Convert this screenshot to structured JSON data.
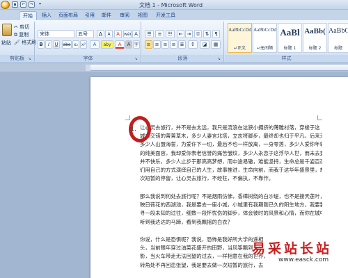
{
  "window": {
    "title": "文档 1 - Microsoft Word"
  },
  "quick_access": [
    "save-icon",
    "undo-icon",
    "redo-icon",
    "dropdown-icon"
  ],
  "tabs": [
    {
      "label": "开始",
      "active": true
    },
    {
      "label": "插入"
    },
    {
      "label": "页面布局"
    },
    {
      "label": "引用"
    },
    {
      "label": "邮件"
    },
    {
      "label": "审阅"
    },
    {
      "label": "视图"
    },
    {
      "label": "开发工具"
    }
  ],
  "ribbon": {
    "clipboard": {
      "label": "剪贴板",
      "paste": "粘贴",
      "cut": "剪切",
      "copy": "复制",
      "format_painter": "格式刷"
    },
    "font": {
      "label": "字体",
      "font_name": "宋体",
      "font_size": "五号",
      "bold": "B",
      "italic": "I",
      "underline": "U",
      "strike": "abe",
      "subscript": "x₂",
      "superscript": "x²",
      "grow": "A",
      "shrink": "A",
      "clear": "A",
      "phonetic": "wén",
      "border_char": "A",
      "highlight": "aby",
      "font_color": "A",
      "shading": "A",
      "circle_char": "字"
    },
    "paragraph": {
      "label": "段落"
    },
    "styles": {
      "label": "样式",
      "items": [
        {
          "preview": "AaBbCcDd",
          "name": "↵正文",
          "selected": true
        },
        {
          "preview": "AaBbCcDd",
          "name": "↵无间隔"
        },
        {
          "preview": "AaBl",
          "name": "标题 1"
        },
        {
          "preview": "AaBb(",
          "name": "标题 2"
        },
        {
          "preview": "AaBbC",
          "name": "标题"
        }
      ]
    }
  },
  "document": {
    "list_number": "1.",
    "paragraphs": [
      [
        "让心灵去旅行，并不是去太远，我只是流浪在这狭小拥挤的薄雕村落，穿梭于这",
        "城市交错的菁菁草木，多少人妻言北塔，立志将脚步，最终却也归于平凡，后来无法，",
        "多少人山盟海誓，为爱许下一切，最后不也一样放离，一身零落，多少人爱你年轻动人",
        "的纯美面容，我却爱你表老信誉的痛苦皱纹，多少人永恋于这浮华人世，而未去更多，",
        "并不快乐，多少人止步于那高高梦想，而中途易辙，难能坚持，生命总是千姿百态，我",
        "们用自己的方式演绎自己的人生，故事推进，生命向前，而我于这华年盛景里，想象一",
        "次短暂的停留，让心灵去旅行，不经狂，不偏执，不靠作。"
      ],
      [
        "那么我说到何处去旅行呢？不是烟雨仿佛，香樟树绕的白沙堤，也不是接天莲叶，",
        "映日荷花的西湖池，我是要去一座小城，小城里有我期刚已久的阳生地方，我要要去探",
        "寻一段未知的过往，细数一段怀忧伤的脚步，体会彼时的风景和心情，而你在城中，是否",
        "听到我达达的马蹄，看到我飘摇的白衣？"
      ],
      [
        "你说，什么是恐惧呢？我说，恐怖是我好所大学的遥相",
        "头，当前眼年穿过油菜花盛开的田野，当风筝飘到云的",
        "影，当火车带走无法回望的过去，一样相意在我的世界，",
        "转角处不再回恋张望，我是要去做一次短暂的旅行，去"
      ]
    ]
  },
  "watermark": {
    "cn": "易采站长站",
    "url": "www.easck.com"
  }
}
